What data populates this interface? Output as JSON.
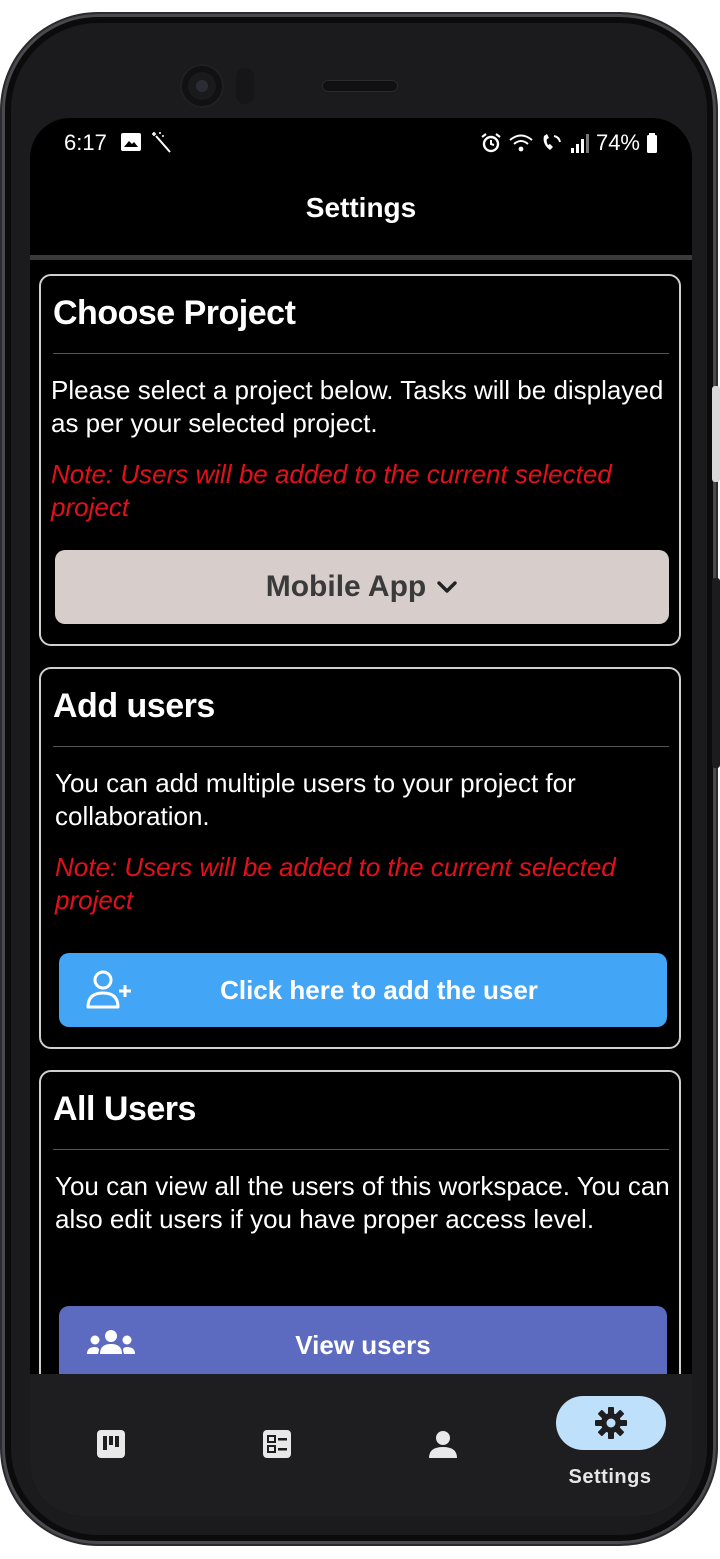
{
  "status_bar": {
    "time": "6:17",
    "battery": "74%"
  },
  "header": {
    "title": "Settings"
  },
  "choose_project": {
    "title": "Choose Project",
    "description": "Please select a project below. Tasks will be displayed as per your selected project.",
    "note": "Note: Users will be added to the current selected project",
    "selected_project": "Mobile App"
  },
  "add_users": {
    "title": "Add users",
    "description": "You can add multiple users to your project for collaboration.",
    "note": "Note: Users will be added to the current selected project",
    "button_label": "Click here to add the user"
  },
  "all_users": {
    "title": "All Users",
    "description": "You can view all the users of this workspace. You can also edit users if you have proper access level.",
    "button_label": "View users"
  },
  "bottom_nav": {
    "items": [
      {
        "icon": "board-icon"
      },
      {
        "icon": "tasks-icon"
      },
      {
        "icon": "person-icon"
      },
      {
        "icon": "gear-icon",
        "label": "Settings",
        "active": true
      }
    ]
  },
  "colors": {
    "note_red": "#e3101b",
    "project_button": "#d7cdca",
    "add_user_button": "#43a5f5",
    "view_users_button": "#5c6bc0",
    "active_nav_pill": "#bfe0fb"
  }
}
